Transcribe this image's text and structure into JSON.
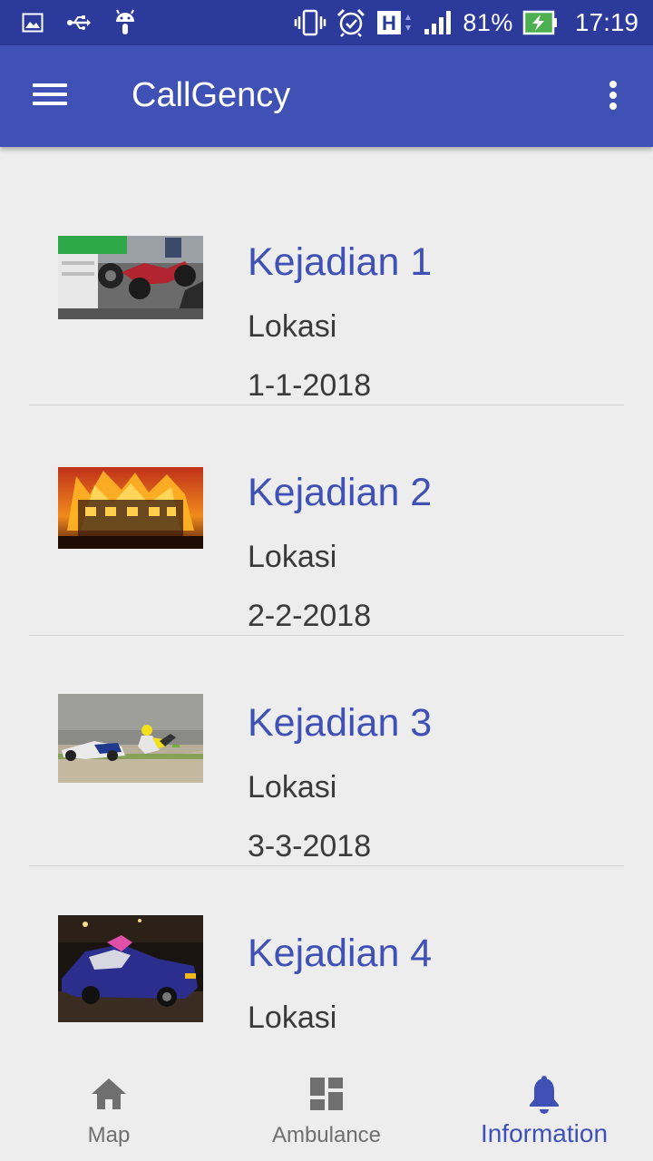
{
  "status_bar": {
    "left_icons": [
      "gallery-icon",
      "usb-icon",
      "android-debug-icon"
    ],
    "right_icons": [
      "vibrate-icon",
      "alarm-icon",
      "hsdpa-icon",
      "signal-icon"
    ],
    "battery": "81%",
    "battery_level": 0.81,
    "time": "17:19"
  },
  "app_bar": {
    "title": "CallGency",
    "menu_icon": "hamburger-menu-icon",
    "overflow_icon": "more-vert-icon"
  },
  "incidents": [
    {
      "title": "Kejadian 1",
      "location": "Lokasi",
      "date": "1-1-2018",
      "image": "motorcycle-truck-accident-photo"
    },
    {
      "title": "Kejadian 2",
      "location": "Lokasi",
      "date": "2-2-2018",
      "image": "house-fire-photo"
    },
    {
      "title": "Kejadian 3",
      "location": "Lokasi",
      "date": "3-3-2018",
      "image": "motorcycle-race-crash-photo"
    },
    {
      "title": "Kejadian 4",
      "location": "Lokasi",
      "date": "",
      "image": "car-crash-night-photo"
    }
  ],
  "bottom_nav": {
    "items": [
      {
        "label": "Map",
        "icon": "home-icon",
        "active": false
      },
      {
        "label": "Ambulance",
        "icon": "dashboard-icon",
        "active": false
      },
      {
        "label": "Information",
        "icon": "bell-icon",
        "active": true
      }
    ]
  },
  "colors": {
    "primary": "#3f51b5",
    "primary_dark": "#2c3a9c",
    "background": "#ededed",
    "nav_inactive": "#6f6f6f",
    "battery_green": "#4caf50"
  }
}
